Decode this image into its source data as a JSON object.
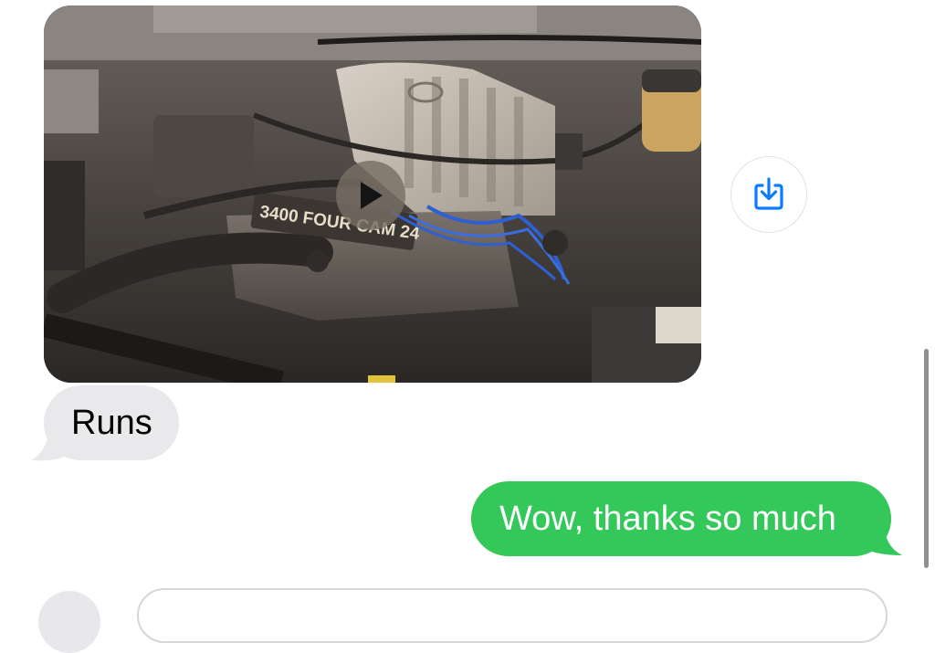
{
  "conversation": {
    "video_message": {
      "engine_badge": "3400 FOUR CAM 24",
      "play_icon": "play-icon",
      "save_icon": "download-icon"
    },
    "messages": [
      {
        "direction": "incoming",
        "text": "Runs",
        "bubble_color": "#e9e9eb"
      },
      {
        "direction": "outgoing",
        "text": "Wow, thanks so much",
        "bubble_color": "#34c759"
      }
    ]
  },
  "colors": {
    "accent": "#0a7cff",
    "outgoing_bubble": "#34c759",
    "incoming_bubble": "#e9e9eb"
  }
}
